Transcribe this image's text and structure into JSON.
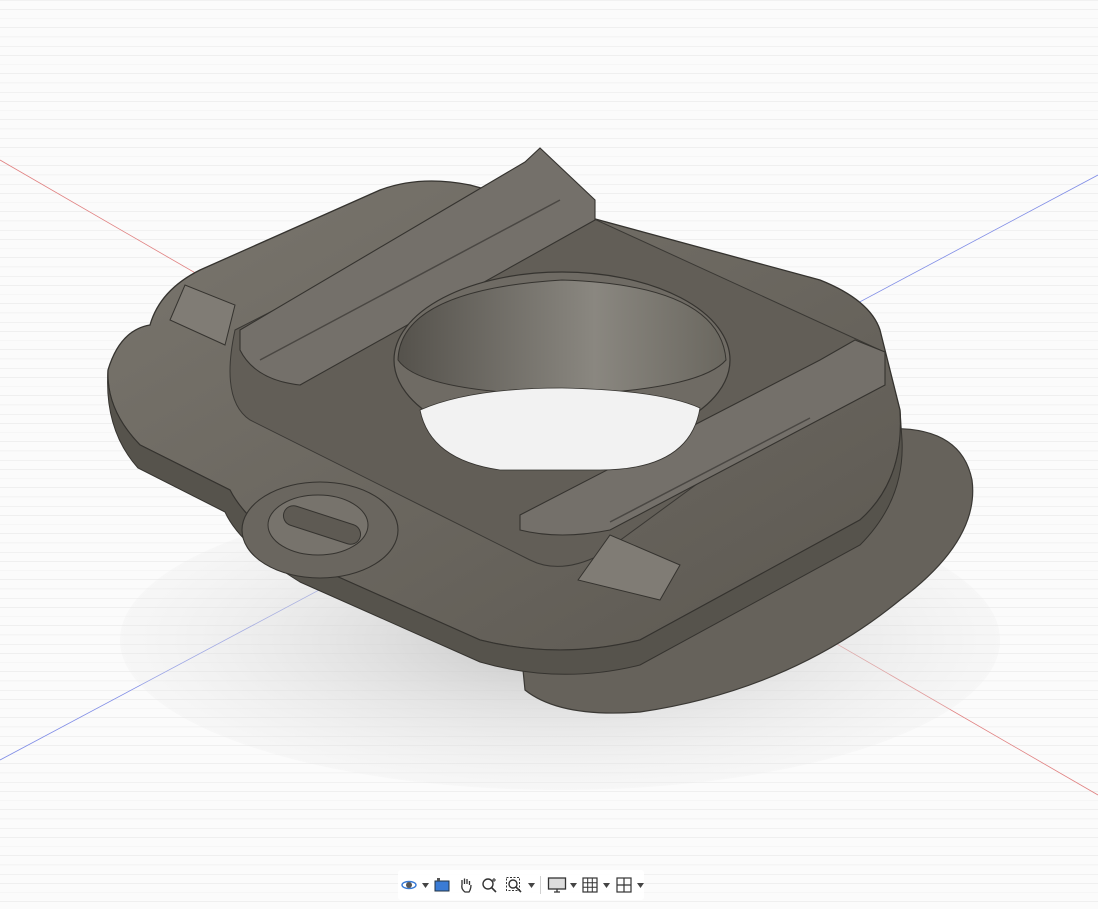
{
  "viewport": {
    "background": "#fbfbfb",
    "grid_minor_color": "#e4e4e4",
    "grid_major_color": "#cfcfcf",
    "x_axis_color": "#e06a6a",
    "y_axis_color": "#6a78e0",
    "model_body_color": "#6e6a62",
    "model_shadow_color": "#c9c9c9"
  },
  "toolbar": {
    "items": [
      {
        "icon": "orbit-icon",
        "has_dropdown": true
      },
      {
        "icon": "look-at-icon",
        "has_dropdown": false
      },
      {
        "icon": "pan-hand-icon",
        "has_dropdown": false
      },
      {
        "icon": "zoom-icon",
        "has_dropdown": false
      },
      {
        "icon": "fit-zoom-window-icon",
        "has_dropdown": true
      },
      {
        "icon": "display-settings-icon",
        "has_dropdown": true
      },
      {
        "icon": "grid-snaps-icon",
        "has_dropdown": true
      },
      {
        "icon": "viewports-icon",
        "has_dropdown": true
      }
    ]
  }
}
